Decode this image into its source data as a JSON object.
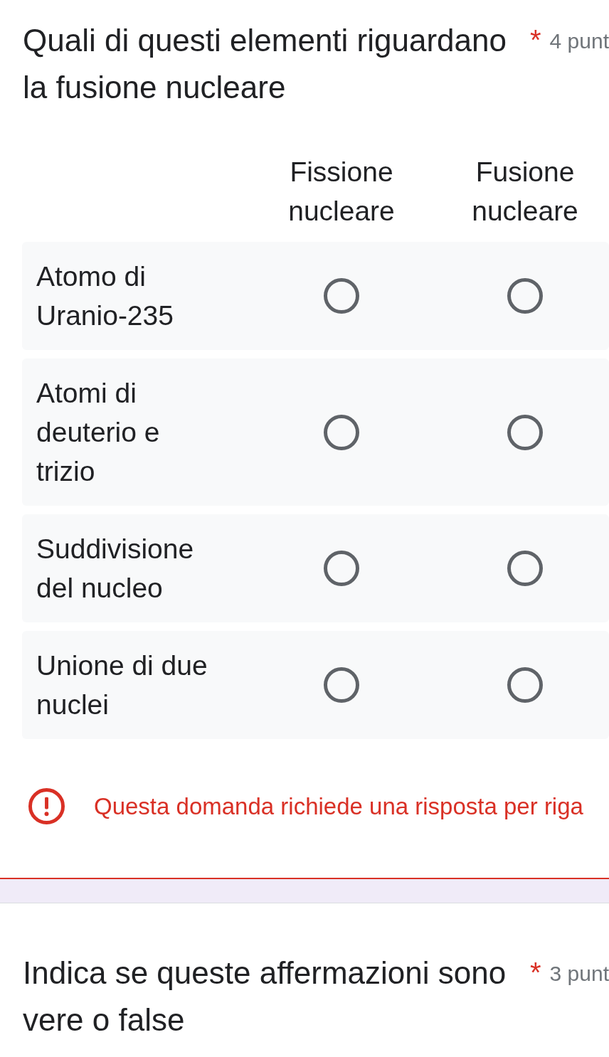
{
  "questions": [
    {
      "title": "Quali di questi elementi riguardano la fusione nucleare",
      "required_mark": "*",
      "points": "4 punt",
      "grid": {
        "columns": [
          "Fissione nucleare",
          "Fusione nucleare"
        ],
        "rows": [
          {
            "label": "Atomo di Uranio-235",
            "choices": [
              {
                "selected": false
              },
              {
                "selected": false
              }
            ]
          },
          {
            "label": "Atomi di deuterio e trizio",
            "choices": [
              {
                "selected": false
              },
              {
                "selected": false
              }
            ]
          },
          {
            "label": "Suddivisione del nucleo",
            "choices": [
              {
                "selected": false
              },
              {
                "selected": false
              }
            ]
          },
          {
            "label": "Unione di due nuclei",
            "choices": [
              {
                "selected": false
              },
              {
                "selected": false
              }
            ]
          }
        ]
      },
      "error": {
        "message": "Questa domanda richiede una risposta per riga"
      }
    },
    {
      "title": "Indica se queste affermazioni sono vere o false",
      "required_mark": "*",
      "points": "3 punt"
    }
  ]
}
